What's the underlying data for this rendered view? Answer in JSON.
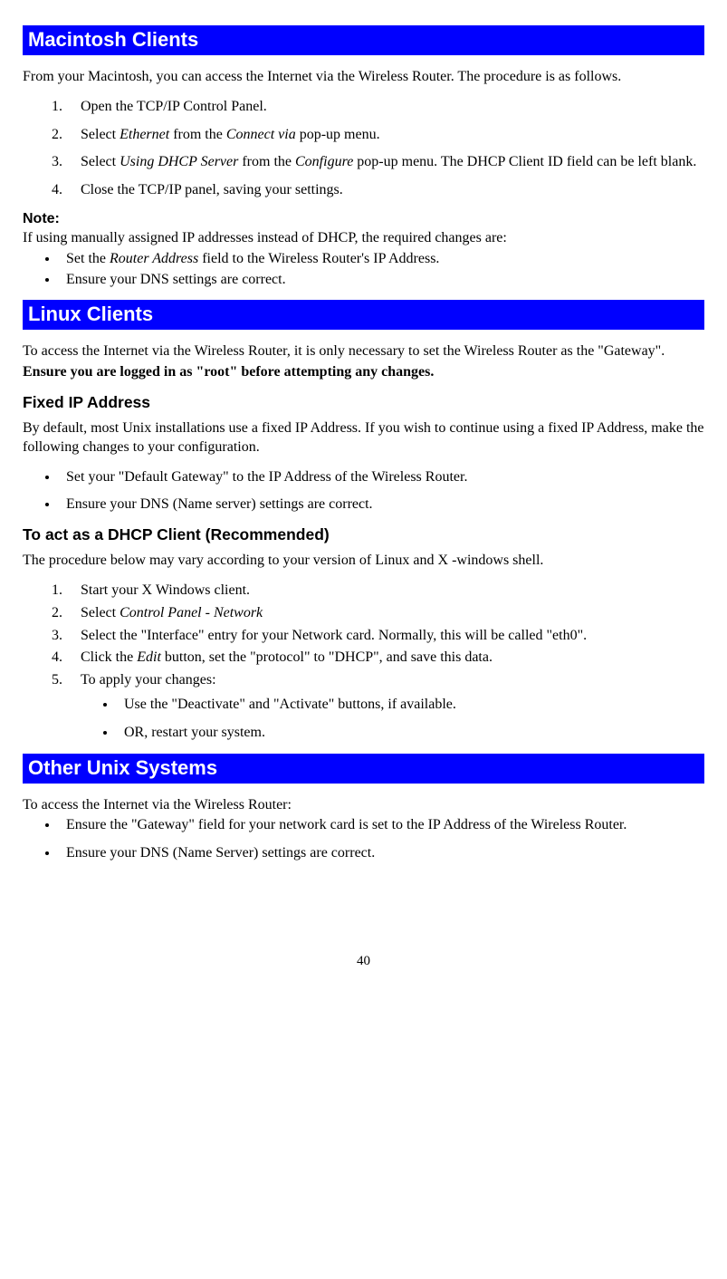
{
  "mac": {
    "header": "Macintosh Clients",
    "intro": "From your Macintosh, you can access the Internet via the Wireless Router. The procedure is as follows.",
    "steps": {
      "s1": "Open the TCP/IP Control Panel.",
      "s2a": "Select ",
      "s2b": "Ethernet",
      "s2c": " from the ",
      "s2d": "Connect via",
      "s2e": " pop-up menu.",
      "s3a": "Select ",
      "s3b": "Using DHCP Server",
      "s3c": " from the ",
      "s3d": "Configure",
      "s3e": " pop-up menu. The DHCP Client ID field can be left blank.",
      "s4": "Close the TCP/IP panel, saving your settings."
    },
    "note_label": "Note:",
    "note_text": "If using manually assigned IP addresses instead of DHCP, the required changes are:",
    "note_b1a": "Set the ",
    "note_b1b": "Router Address",
    "note_b1c": " field to the Wireless Router's IP Address.",
    "note_b2": "Ensure your DNS settings are correct."
  },
  "linux": {
    "header": "Linux Clients",
    "intro": "To access the Internet via the Wireless Router, it is only necessary to set the Wireless Router as the \"Gateway\".",
    "root_warning": "Ensure you are logged in as \"root\" before attempting any changes.",
    "fixed_header": "Fixed IP Address",
    "fixed_text": "By default, most Unix installations use a fixed IP Address. If you wish to continue using a fixed IP Address, make the following changes to your configuration.",
    "fixed_b1": "Set your \"Default Gateway\" to the IP Address of the Wireless Router.",
    "fixed_b2": "Ensure your DNS (Name server) settings are correct.",
    "dhcp_header": "To act as a DHCP Client (Recommended)",
    "dhcp_intro": "The procedure below may vary according to your version of Linux and X -windows shell.",
    "dhcp": {
      "s1": "Start your X Windows client.",
      "s2a": "Select ",
      "s2b": "Control Panel - Network",
      "s3": "Select the \"Interface\" entry for your Network card. Normally, this will be called \"eth0\".",
      "s4a": "Click the ",
      "s4b": "Edit",
      "s4c": " button, set the \"protocol\" to \"DHCP\", and save this data.",
      "s5": "To apply your changes:",
      "s5b1": "Use the \"Deactivate\" and \"Activate\" buttons, if available.",
      "s5b2": "OR, restart your system."
    }
  },
  "unix": {
    "header": "Other Unix Systems",
    "intro": "To access the Internet via the Wireless Router:",
    "b1": "Ensure the \"Gateway\" field for your network card is set to the IP Address of the Wireless Router.",
    "b2": "Ensure your DNS (Name Server) settings are correct."
  },
  "page_number": "40"
}
